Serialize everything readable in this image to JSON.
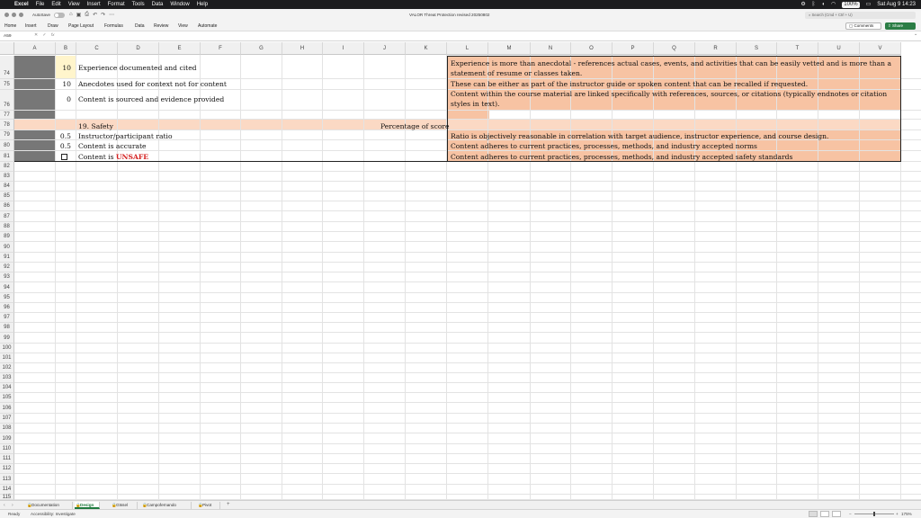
{
  "menubar": {
    "app_name": "Excel",
    "items": [
      "File",
      "Edit",
      "View",
      "Insert",
      "Format",
      "Tools",
      "Data",
      "Window",
      "Help"
    ],
    "battery": "100%",
    "datetime": "Sat Aug 9  14:23"
  },
  "titlebar": {
    "autosave_label": "AutoSave",
    "document_title": "VALOR Threat Protection revised 20250802",
    "search_placeholder": "Search (Cmd + Ctrl + U)"
  },
  "ribbon": {
    "tabs": [
      "Home",
      "Insert",
      "Draw",
      "Page Layout",
      "Formulas",
      "Data",
      "Review",
      "View",
      "Automate"
    ],
    "comments_label": "Comments",
    "share_label": "Share"
  },
  "formula_bar": {
    "name_box": "A59",
    "fx_label": "fx",
    "content": ""
  },
  "grid": {
    "columns": [
      "A",
      "B",
      "C",
      "D",
      "E",
      "F",
      "G",
      "H",
      "I",
      "J",
      "K",
      "L",
      "M",
      "N",
      "O",
      "P",
      "Q",
      "R",
      "S",
      "T",
      "U",
      "V"
    ],
    "rows": [
      {
        "label": "74"
      },
      {
        "label": "75"
      },
      {
        "label": "76"
      },
      {
        "label": "77"
      },
      {
        "label": "78"
      },
      {
        "label": "79"
      },
      {
        "label": "80"
      },
      {
        "label": "81"
      },
      {
        "label": "82"
      },
      {
        "label": "83"
      },
      {
        "label": "84"
      },
      {
        "label": "85"
      },
      {
        "label": "86"
      },
      {
        "label": "87"
      },
      {
        "label": "88"
      },
      {
        "label": "89"
      },
      {
        "label": "90"
      },
      {
        "label": "91"
      },
      {
        "label": "92"
      },
      {
        "label": "93"
      },
      {
        "label": "94"
      },
      {
        "label": "95"
      },
      {
        "label": "96"
      },
      {
        "label": "97"
      },
      {
        "label": "98"
      },
      {
        "label": "99"
      },
      {
        "label": "100"
      },
      {
        "label": "101"
      },
      {
        "label": "102"
      },
      {
        "label": "103"
      },
      {
        "label": "104"
      },
      {
        "label": "105"
      },
      {
        "label": "106"
      },
      {
        "label": "107"
      },
      {
        "label": "108"
      },
      {
        "label": "109"
      },
      {
        "label": "110"
      },
      {
        "label": "111"
      },
      {
        "label": "112"
      },
      {
        "label": "113"
      },
      {
        "label": "114"
      },
      {
        "label": "115"
      }
    ]
  },
  "cells": {
    "b74": "10",
    "c74": "Experience documented and cited",
    "l74": "Experience is more than anecdotal - references actual cases, events, and activities that can be easily vetted and is more than a statement of resume or classes taken.",
    "b75": "10",
    "c75": "Anecdotes used for context not for content",
    "l75": "These can be either as part of the instructor guide or spoken content that can be recalled if requested.",
    "b76": "0",
    "c76": "Content is sourced and evidence provided",
    "l76": "Content within the course material are linked specifically with references, sources, or citations (typically endnotes or citation styles in text).",
    "c78": "19. Safety",
    "k78": "Percentage of score",
    "b79": "0.5",
    "c79": "Instructor/participant ratio",
    "l79": "Ratio is objectively reasonable in correlation with target audience, instructor experience, and course design.",
    "b80": "0.5",
    "c80": "Content is accurate",
    "l80": "Content adheres to current practices, processes, methods, and industry accepted norms",
    "c81_prefix": "Content is ",
    "c81_flag": "UNSAFE",
    "l81": "Content adheres to current practices, processes, methods, and industry accepted safety standards"
  },
  "colors": {
    "salmon": "#f7c3a3",
    "light_salmon": "#fbd9c4",
    "dark_gray": "#777777",
    "yellow_cell": "#fff5cc",
    "unsafe_red": "#d41f1f"
  },
  "sheet_tabs": [
    "Documentation",
    "Design",
    "Gtssel",
    "Campofernando",
    "Pivot"
  ],
  "active_sheet": "Design",
  "statusbar": {
    "ready": "Ready",
    "accessibility": "Accessibility: Investigate",
    "zoom": "175%"
  }
}
